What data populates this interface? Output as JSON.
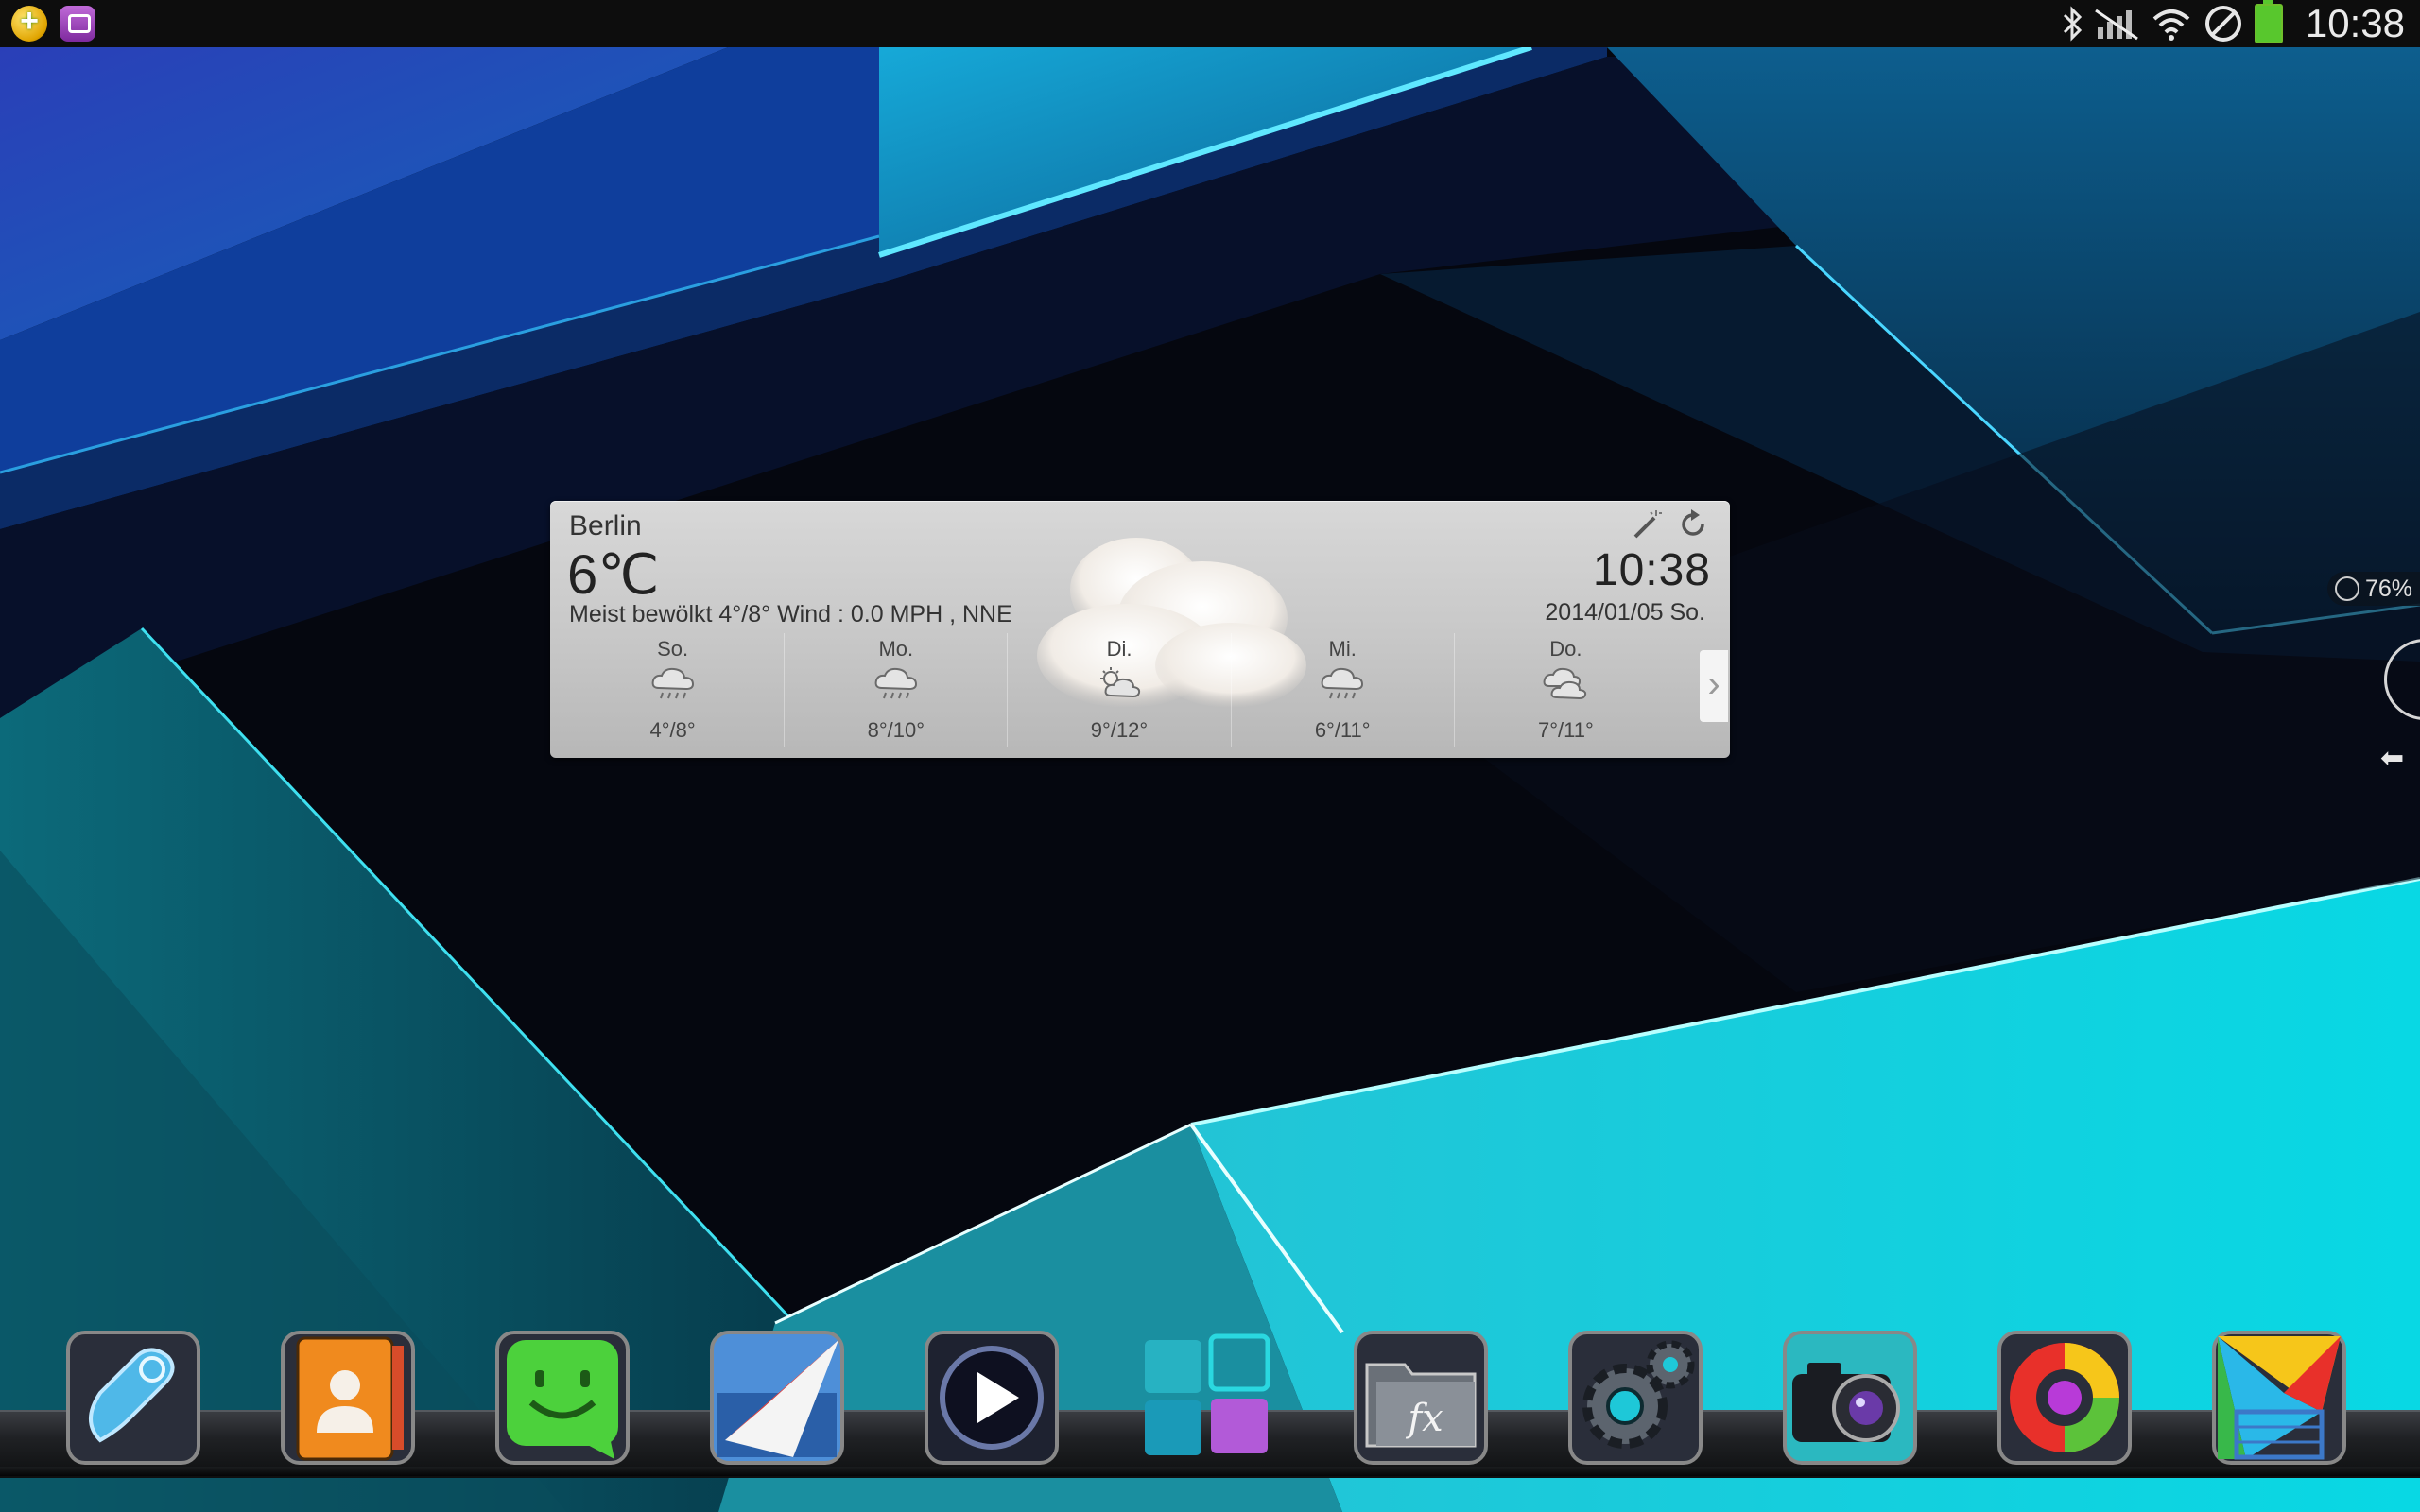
{
  "statusbar": {
    "time": "10:38",
    "notifications": [
      "add-notification-icon",
      "message-notification-icon"
    ],
    "indicators": [
      "bluetooth-icon",
      "signal-off-icon",
      "wifi-icon",
      "blocked-icon",
      "battery-icon"
    ],
    "battery_color": "#58c72d"
  },
  "weather": {
    "city": "Berlin",
    "temp": "6℃",
    "description": "Meist bewölkt 4°/8°  Wind : 0.0 MPH , NNE",
    "time": "10:38",
    "date": "2014/01/05 So.",
    "forecast": [
      {
        "day": "So.",
        "range": "4°/8°",
        "icon": "rain-cloud-icon"
      },
      {
        "day": "Mo.",
        "range": "8°/10°",
        "icon": "rain-cloud-icon"
      },
      {
        "day": "Di.",
        "range": "9°/12°",
        "icon": "sun-cloud-icon"
      },
      {
        "day": "Mi.",
        "range": "6°/11°",
        "icon": "rain-cloud-icon"
      },
      {
        "day": "Do.",
        "range": "7°/11°",
        "icon": "cloud-icon"
      }
    ]
  },
  "edge": {
    "memory": "76%"
  },
  "dock": {
    "apps": [
      "phone-app-icon",
      "contacts-app-icon",
      "messaging-app-icon",
      "email-app-icon",
      "video-player-app-icon",
      "app-drawer-icon",
      "file-explorer-app-icon",
      "settings-app-icon",
      "camera-app-icon",
      "browser-app-icon",
      "play-store-app-icon"
    ]
  },
  "colors": {
    "accent_cyan": "#16e0e6",
    "background_dark": "#05070f"
  }
}
